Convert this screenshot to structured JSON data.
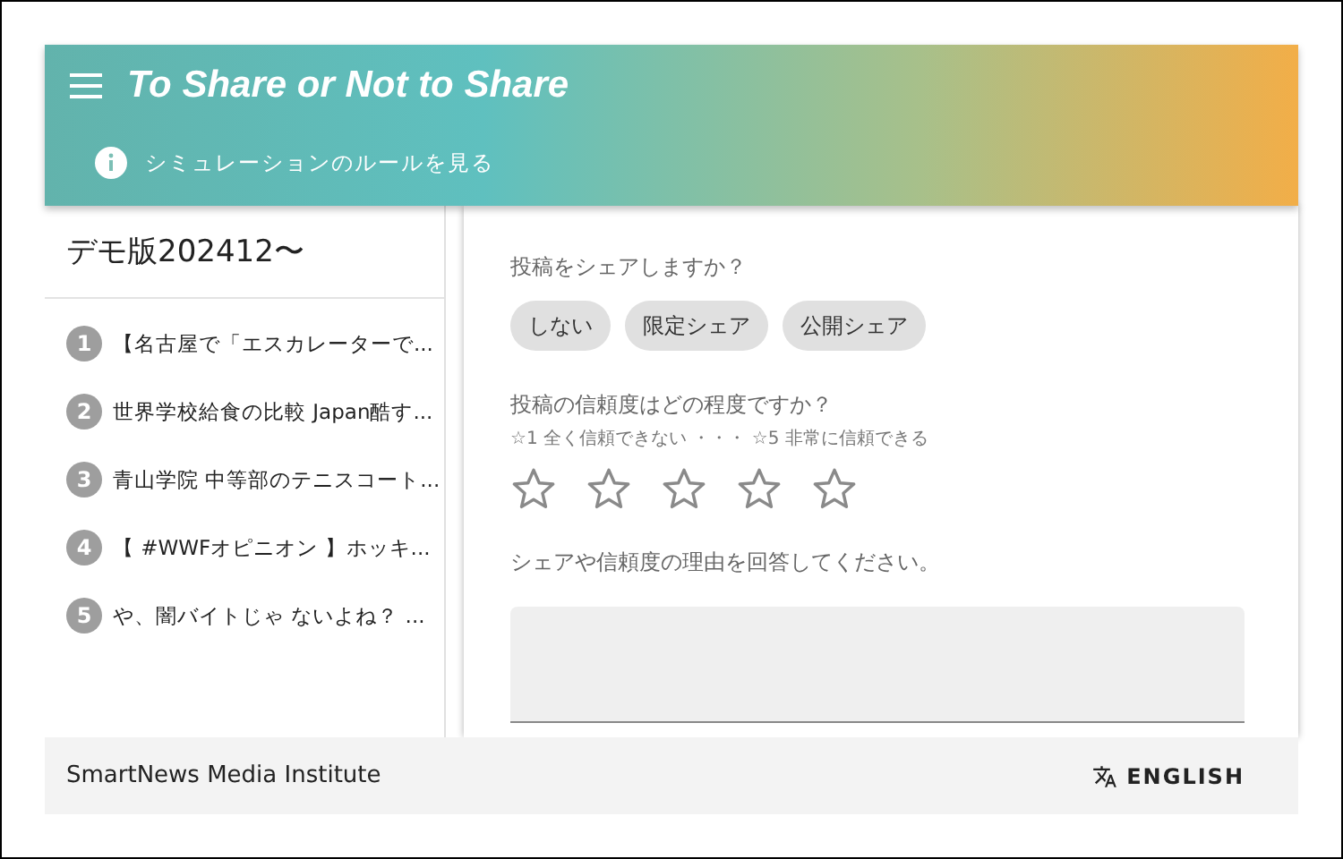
{
  "header": {
    "title": "To Share or Not to Share",
    "rules_link": "シミュレーションのルールを見る"
  },
  "sidebar": {
    "title": "デモ版202412〜",
    "items": [
      {
        "number": "1",
        "label": "【名古屋で「エスカレーターで..."
      },
      {
        "number": "2",
        "label": "世界学校給食の比較 Japan酷す..."
      },
      {
        "number": "3",
        "label": "青山学院 中等部のテニスコート..."
      },
      {
        "number": "4",
        "label": "【 #WWFオピニオン 】ホッキ..."
      },
      {
        "number": "5",
        "label": "や、闇バイトじゃ ないよね？ ..."
      }
    ]
  },
  "form": {
    "share_question": "投稿をシェアしますか？",
    "share_options": [
      {
        "label": "しない",
        "selected": false
      },
      {
        "label": "限定シェア",
        "selected": false
      },
      {
        "label": "公開シェア",
        "selected": false
      }
    ],
    "trust_question": "投稿の信頼度はどの程度ですか？",
    "trust_hint": "☆1 全く信頼できない ・・・ ☆5 非常に信頼できる",
    "stars": 0,
    "reason_prompt": "シェアや信頼度の理由を回答してください。"
  },
  "footer": {
    "org": "SmartNews Media Institute",
    "language_button": "ENGLISH"
  }
}
